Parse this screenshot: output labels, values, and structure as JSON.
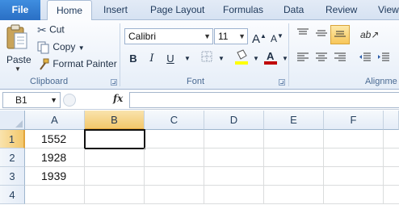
{
  "tabs": {
    "file": "File",
    "items": [
      "Home",
      "Insert",
      "Page Layout",
      "Formulas",
      "Data",
      "Review",
      "View"
    ]
  },
  "clipboard": {
    "paste": "Paste",
    "cut": "Cut",
    "copy": "Copy",
    "format_painter": "Format Painter",
    "group_label": "Clipboard"
  },
  "font": {
    "name": "Calibri",
    "size": "11",
    "group_label": "Font",
    "grow": "A",
    "shrink": "A",
    "bold": "B",
    "italic": "I",
    "underline": "U"
  },
  "alignment": {
    "group_label": "Alignme"
  },
  "formula_bar": {
    "name_box": "B1",
    "fx": "fx",
    "content": ""
  },
  "sheet": {
    "columns": [
      "A",
      "B",
      "C",
      "D",
      "E",
      "F"
    ],
    "rows": [
      "1",
      "2",
      "3",
      "4"
    ],
    "cells": [
      [
        "1552",
        "",
        "",
        "",
        "",
        ""
      ],
      [
        "1928",
        "",
        "",
        "",
        "",
        ""
      ],
      [
        "1939",
        "",
        "",
        "",
        "",
        ""
      ],
      [
        "",
        "",
        "",
        "",
        "",
        ""
      ]
    ],
    "active_cell": "B1"
  },
  "colors": {
    "file_tab": "#2a6fc4",
    "font_color_bar": "#c00000",
    "highlight_bar": "#ffff00",
    "selection_header": "#f3c86c"
  }
}
